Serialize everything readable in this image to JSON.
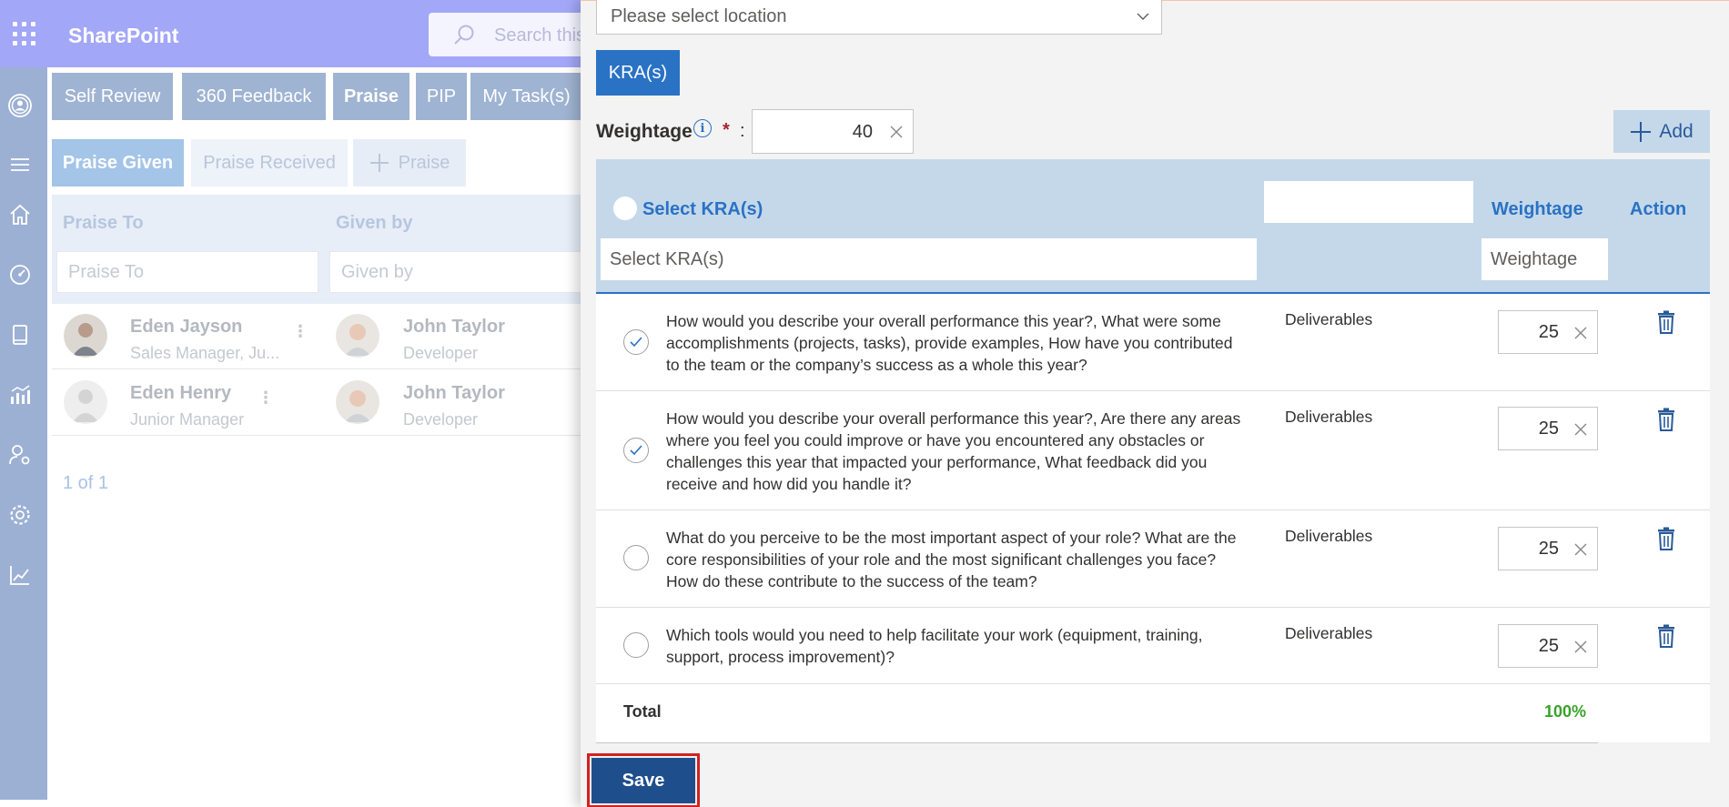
{
  "app": {
    "brand": "SharePoint",
    "search_placeholder": "Search this"
  },
  "nav_tabs": [
    {
      "label": "Self Review"
    },
    {
      "label": "360 Feedback"
    },
    {
      "label": "Praise"
    },
    {
      "label": "PIP"
    },
    {
      "label": "My Task(s)"
    }
  ],
  "praise": {
    "subtabs": {
      "given": "Praise Given",
      "received": "Praise Received",
      "add": "Praise"
    },
    "columns": {
      "praise_to": "Praise To",
      "given_by": "Given by"
    },
    "filters": {
      "praise_to": "Praise To",
      "given_by": "Given by"
    },
    "rows": [
      {
        "to_name": "Eden Jayson",
        "to_role": "Sales Manager, Ju...",
        "by_name": "John Taylor",
        "by_role": "Developer"
      },
      {
        "to_name": "Eden Henry",
        "to_role": "Junior Manager",
        "by_name": "John Taylor",
        "by_role": "Developer"
      }
    ],
    "pager": "1 of 1"
  },
  "panel": {
    "location_placeholder": "Please select location",
    "kra_button": "KRA(s)",
    "weightage_label": "Weightage",
    "required_mark": "*",
    "colon": ":",
    "info_glyph": "i",
    "weightage_value": "40",
    "add_label": "Add",
    "grid": {
      "select_label": "Select KRA(s)",
      "select_placeholder": "Select KRA(s)",
      "weightage_header": "Weightage",
      "weightage_placeholder": "Weightage",
      "action_header": "Action"
    },
    "kras": [
      {
        "text": "How would you describe your overall performance this year?, What were some accomplishments (projects, tasks), provide examples, How have you contributed to the team or the company’s success as a whole this year?",
        "type": "Deliverables",
        "weight": "25",
        "checked": true
      },
      {
        "text": "How would you describe your overall performance this year?, Are there any areas where you feel you could improve or have you encountered any obstacles or challenges this year that impacted your performance, What feedback did you receive and how did you handle it?",
        "type": "Deliverables",
        "weight": "25",
        "checked": true
      },
      {
        "text": "What do you perceive to be the most important aspect of your role? What are the core responsibilities of your role and the most significant challenges you face? How do these contribute to the success of the team?",
        "type": "Deliverables",
        "weight": "25",
        "checked": false
      },
      {
        "text": "Which tools would you need to help facilitate your work (equipment, training, support, process improvement)?",
        "type": "Deliverables",
        "weight": "25",
        "checked": false
      }
    ],
    "total_label": "Total",
    "total_value": "100%",
    "save_label": "Save"
  },
  "colors": {
    "accent": "#2a72c4",
    "save": "#1f4e8c",
    "highlight": "#d32020",
    "total_green": "#3aa12b",
    "header_purple": "#a3a7f7"
  }
}
